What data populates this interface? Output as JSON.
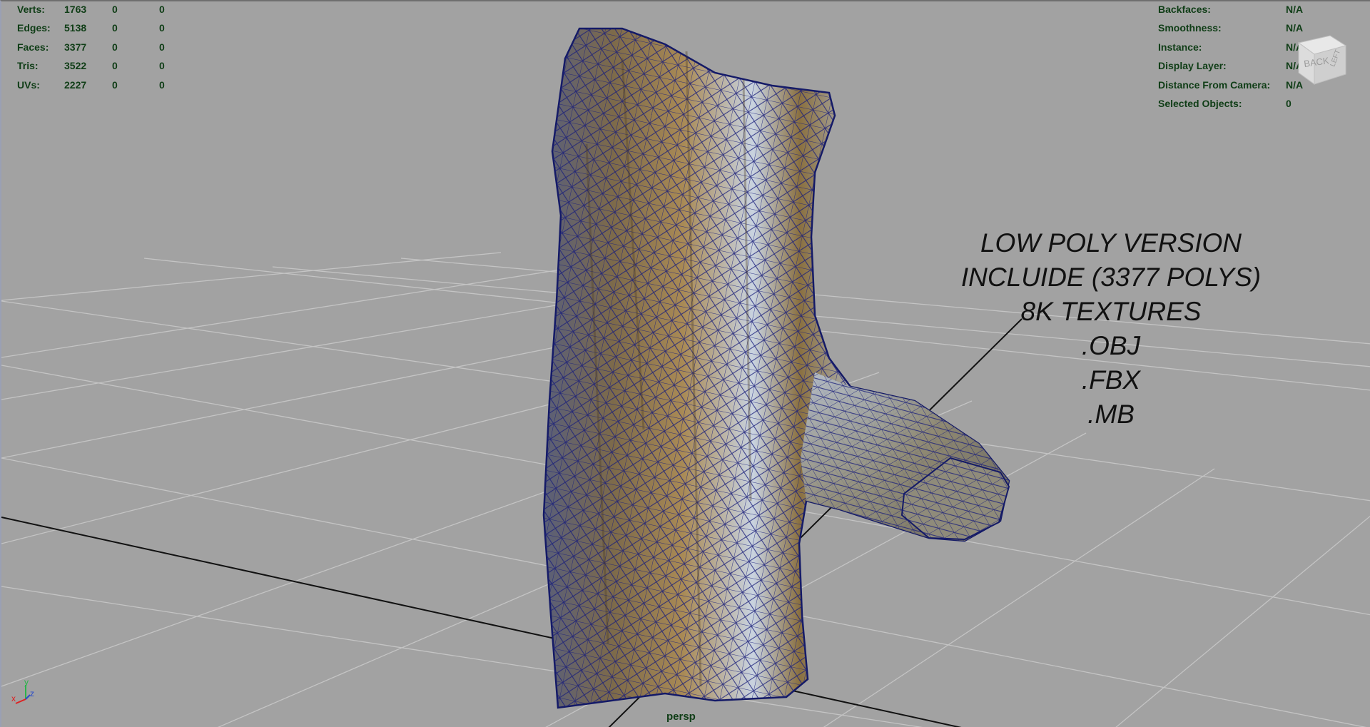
{
  "stats_left": {
    "rows": [
      {
        "label": "Verts:",
        "values": [
          "1763",
          "0",
          "0"
        ]
      },
      {
        "label": "Edges:",
        "values": [
          "5138",
          "0",
          "0"
        ]
      },
      {
        "label": "Faces:",
        "values": [
          "3377",
          "0",
          "0"
        ]
      },
      {
        "label": "Tris:",
        "values": [
          "3522",
          "0",
          "0"
        ]
      },
      {
        "label": "UVs:",
        "values": [
          "2227",
          "0",
          "0"
        ]
      }
    ]
  },
  "stats_right": {
    "rows": [
      {
        "label": "Backfaces:",
        "value": "N/A"
      },
      {
        "label": "Smoothness:",
        "value": "N/A"
      },
      {
        "label": "Instance:",
        "value": "N/A"
      },
      {
        "label": "Display Layer:",
        "value": "N/A"
      },
      {
        "label": "Distance From Camera:",
        "value": "N/A"
      },
      {
        "label": "Selected Objects:",
        "value": "0"
      }
    ]
  },
  "overlay_text": [
    "LOW POLY VERSION",
    "INCLUIDE (3377 POLYS)",
    "8K TEXTURES",
    ".OBJ",
    ".FBX",
    ".MB"
  ],
  "view_cube": {
    "front_label": "BACK",
    "side_label": "LEFT"
  },
  "axis": {
    "x": "x",
    "y": "y",
    "z": "z"
  },
  "camera_label": "persp",
  "colors": {
    "hud_text": "#0f3d16",
    "viewport_bg": "#a2a2a2",
    "grid_line": "#c4c4c4",
    "wireframe": "#1a1f7a"
  },
  "icons": [
    "view-cube-icon",
    "axis-gizmo-icon"
  ]
}
